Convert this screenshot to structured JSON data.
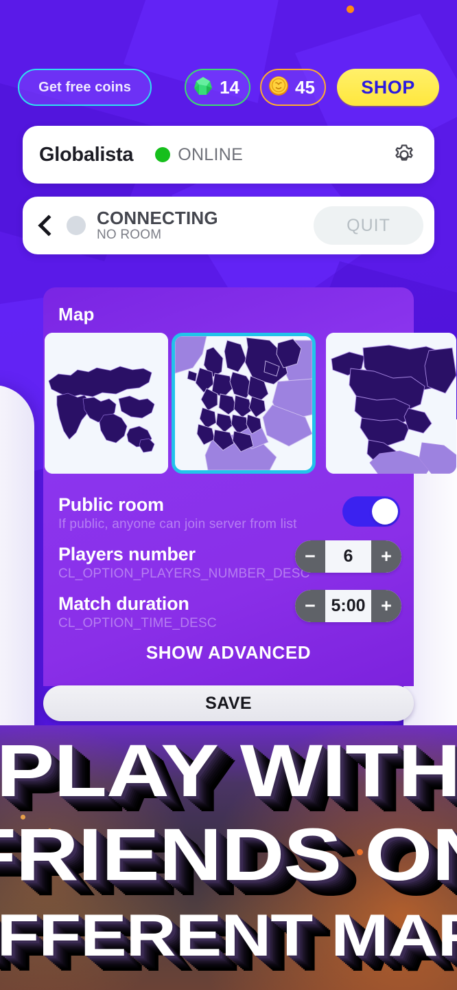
{
  "topbar": {
    "free_coins_label": "Get free coins",
    "gem_icon": "gem-icon",
    "gem_count": "14",
    "coin_icon": "coin-icon",
    "coin_count": "45",
    "shop_label": "SHOP"
  },
  "status": {
    "notification_dot_color": "#ff8a14"
  },
  "profile": {
    "name": "Globalista",
    "online_label": "ONLINE",
    "online_dot_color": "#16bf1c",
    "settings_icon": "gear-icon"
  },
  "connection": {
    "back_icon": "chevron-left-icon",
    "state_dot_color": "#d6dbe2",
    "title": "CONNECTING",
    "subtitle": "NO ROOM",
    "quit_label": "QUIT"
  },
  "settings": {
    "map_label": "Map",
    "maps": [
      {
        "name": "world-map",
        "selected": false
      },
      {
        "name": "europe-middle-east-map",
        "selected": true
      },
      {
        "name": "north-america-map",
        "selected": false
      }
    ],
    "options": [
      {
        "title": "Public room",
        "desc": "If public, anyone can join server from list",
        "control": "toggle",
        "value": "on"
      },
      {
        "title": "Players number",
        "desc": "CL_OPTION_PLAYERS_NUMBER_DESC",
        "control": "stepper",
        "value": "6",
        "minus": "−",
        "plus": "+"
      },
      {
        "title": "Match duration",
        "desc": "CL_OPTION_TIME_DESC",
        "control": "stepper",
        "value": "5:00",
        "minus": "−",
        "plus": "+"
      }
    ],
    "show_advanced_label": "SHOW ADVANCED",
    "save_label": "SAVE"
  },
  "hero": {
    "lines": [
      "PLAY WITH",
      "FRIENDS ON",
      "DIFFERENT MAPS"
    ]
  },
  "colors": {
    "background_purple": "#5a1ae8",
    "panel_purple": "#8b35ee",
    "accent_cyan": "#22c3ea",
    "accent_yellow": "#ffe73d",
    "accent_green": "#3ddc6f",
    "accent_orange": "#ffad2e",
    "toggle_on": "#3b22f0",
    "map_land_dark": "#2a1066",
    "map_land_light": "#9d82e0",
    "map_sea": "#f3f7fd"
  }
}
